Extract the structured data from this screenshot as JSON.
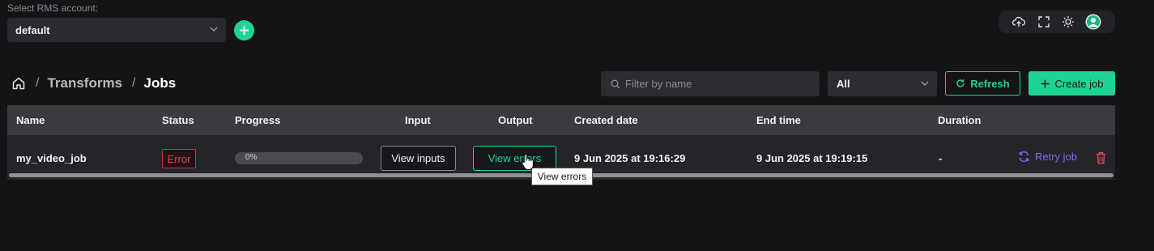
{
  "account": {
    "label": "Select RMS account:",
    "selected": "default"
  },
  "toolbar": {
    "icons": [
      "upload-cloud-icon",
      "fullscreen-icon",
      "brightness-icon",
      "user-avatar-icon"
    ]
  },
  "breadcrumb": {
    "items": [
      "Transforms",
      "Jobs"
    ]
  },
  "filters": {
    "search_placeholder": "Filter by name",
    "status_selected": "All",
    "refresh_label": "Refresh",
    "create_label": "Create job"
  },
  "table": {
    "columns": [
      "Name",
      "Status",
      "Progress",
      "Input",
      "Output",
      "Created date",
      "End time",
      "Duration"
    ],
    "rows": [
      {
        "name": "my_video_job",
        "status": "Error",
        "progress": 0,
        "progress_text": "0%",
        "input_button": "View inputs",
        "output_button": "View errors",
        "created": "9 Jun 2025 at 19:16:29",
        "end": "9 Jun 2025 at 19:19:15",
        "duration": "-",
        "retry_label": "Retry job"
      }
    ]
  },
  "tooltip": "View errors",
  "colors": {
    "accent": "#1fd393",
    "error": "#e0405c",
    "retry": "#7b6cf6",
    "delete": "#e0405c"
  }
}
